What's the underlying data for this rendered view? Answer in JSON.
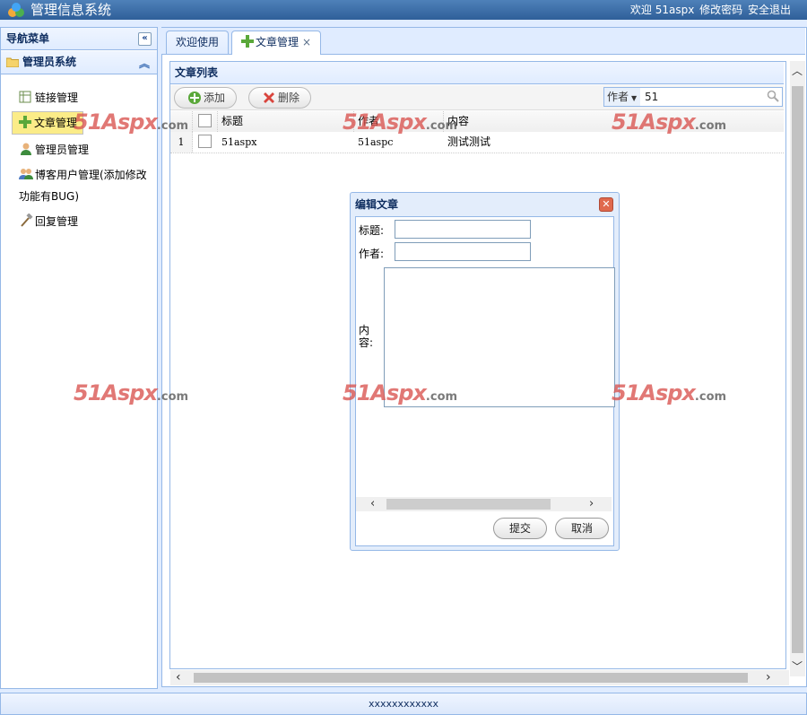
{
  "header": {
    "title": "管理信息系统",
    "welcome": "欢迎 51aspx",
    "change_password": "修改密码",
    "logout": "安全退出"
  },
  "west": {
    "title": "导航菜单",
    "section": "管理员系统",
    "items": [
      {
        "label": "链接管理"
      },
      {
        "label": "文章管理"
      },
      {
        "label": "管理员管理"
      },
      {
        "label": "博客用户管理(添加修改"
      },
      {
        "label": "功能有BUG)"
      },
      {
        "label": "回复管理"
      }
    ]
  },
  "tabs": [
    {
      "label": "欢迎使用"
    },
    {
      "label": "文章管理"
    }
  ],
  "grid": {
    "title": "文章列表",
    "toolbar": {
      "add": "添加",
      "delete": "删除"
    },
    "search": {
      "field": "作者",
      "value": "51"
    },
    "columns": [
      "标题",
      "作者",
      "内容"
    ],
    "rows": [
      {
        "num": "1",
        "title": "51aspx",
        "author": "51aspc",
        "content": "测试测试"
      }
    ]
  },
  "dialog": {
    "title": "编辑文章",
    "label_title": "标题:",
    "label_author": "作者:",
    "label_content": "内\n容:",
    "submit": "提交",
    "cancel": "取消"
  },
  "footer": {
    "text": "xxxxxxxxxxxx"
  },
  "watermark": {
    "brand": "51Aspx",
    "suffix": ".com"
  },
  "colors": {
    "header": "#2f5f99",
    "border": "#95b8e7",
    "panel": "#e0ecff",
    "watermark": "#d9534f"
  }
}
